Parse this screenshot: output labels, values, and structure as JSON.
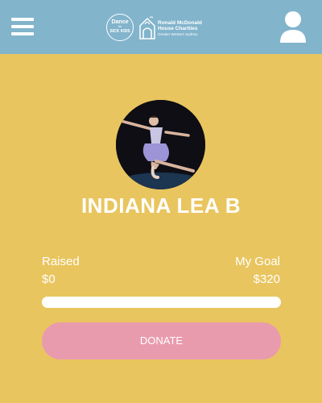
{
  "header": {
    "menu_icon": "hamburger-menu-icon",
    "logo_dance": {
      "line1": "Dance",
      "line2": "for",
      "line3": "SICK KIDS"
    },
    "logo_rmhc": {
      "line1": "Ronald McDonald",
      "line2": "House Charities",
      "line3": "Greater Western Sydney"
    },
    "user_icon": "user-profile-icon"
  },
  "profile": {
    "name": "INDIANA LEA B"
  },
  "fundraising": {
    "raised_label": "Raised",
    "raised_value": "$0",
    "goal_label": "My Goal",
    "goal_value": "$320",
    "progress_fraction": 0
  },
  "donate_label": "DONATE",
  "colors": {
    "background": "#e9c55f",
    "header": "#82b4cc",
    "button": "#e99bae",
    "text": "#ffffff"
  }
}
